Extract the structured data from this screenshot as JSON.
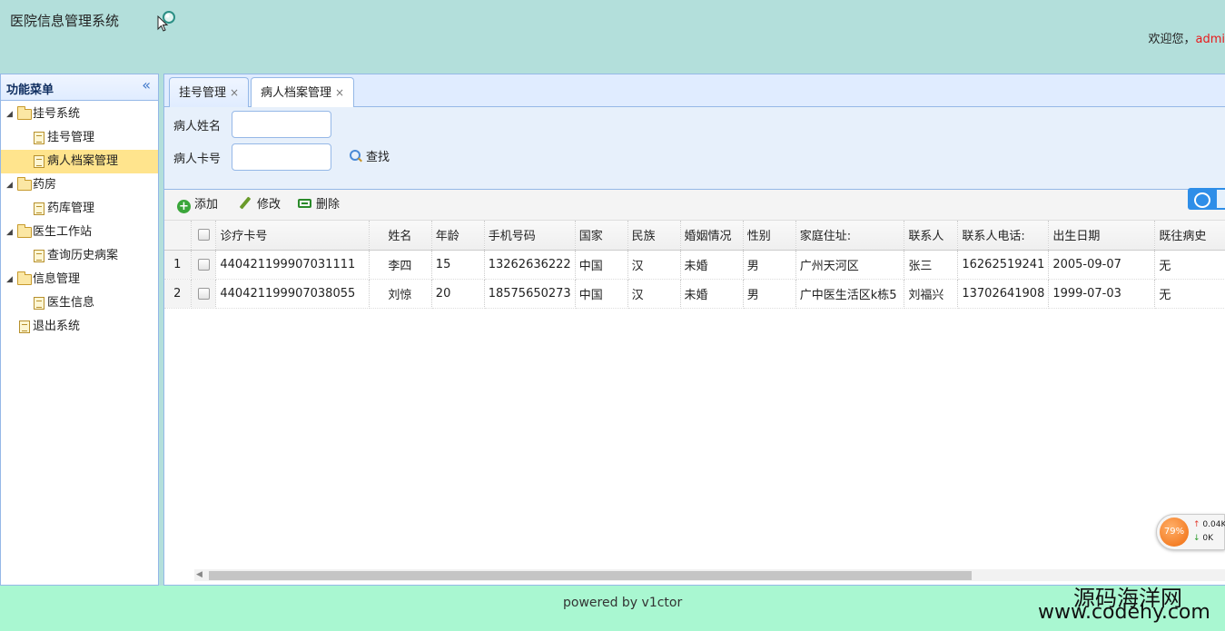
{
  "header": {
    "title": "医院信息管理系统",
    "welcome_text": "欢迎您，",
    "username": "admi"
  },
  "sidebar": {
    "title": "功能菜单",
    "collapse_glyph": "«",
    "groups": [
      {
        "label": "挂号系统",
        "items": [
          {
            "label": "挂号管理"
          },
          {
            "label": "病人档案管理"
          }
        ]
      },
      {
        "label": "药房",
        "items": [
          {
            "label": "药库管理"
          }
        ]
      },
      {
        "label": "医生工作站",
        "items": [
          {
            "label": "查询历史病案"
          }
        ]
      },
      {
        "label": "信息管理",
        "items": [
          {
            "label": "医生信息"
          }
        ]
      }
    ],
    "logout": "退出系统",
    "selected": "病人档案管理"
  },
  "tabs": [
    {
      "label": "挂号管理",
      "close": "×"
    },
    {
      "label": "病人档案管理",
      "close": "×"
    }
  ],
  "search": {
    "name_label": "病人姓名",
    "name_value": "",
    "card_label": "病人卡号",
    "card_value": "",
    "find_label": "查找"
  },
  "toolbar": {
    "add_label": "添加",
    "edit_label": "修改",
    "delete_label": "删除"
  },
  "table": {
    "columns": [
      "诊疗卡号",
      "姓名",
      "年龄",
      "手机号码",
      "国家",
      "民族",
      "婚姻情况",
      "性别",
      "家庭住址:",
      "联系人",
      "联系人电话:",
      "出生日期",
      "既往病史"
    ],
    "rows": [
      {
        "num": "1",
        "cells": [
          "440421199907031111",
          "李四",
          "15",
          "13262636222",
          "中国",
          "汉",
          "未婚",
          "男",
          "广州天河区",
          "张三",
          "16262519241",
          "2005-09-07",
          "无"
        ]
      },
      {
        "num": "2",
        "cells": [
          "440421199907038055",
          "刘惊",
          "20",
          "18575650273",
          "中国",
          "汉",
          "未婚",
          "男",
          "广中医生活区k栋5",
          "刘福兴",
          "13702641908",
          "1999-07-03",
          "无"
        ]
      }
    ]
  },
  "net_widget": {
    "percent": "79%",
    "up": "0.04K",
    "down": "0K"
  },
  "footer": {
    "text": "powered by v1ctor",
    "watermark_cn": "源码海洋网",
    "watermark_url": "www.codehy.com"
  }
}
